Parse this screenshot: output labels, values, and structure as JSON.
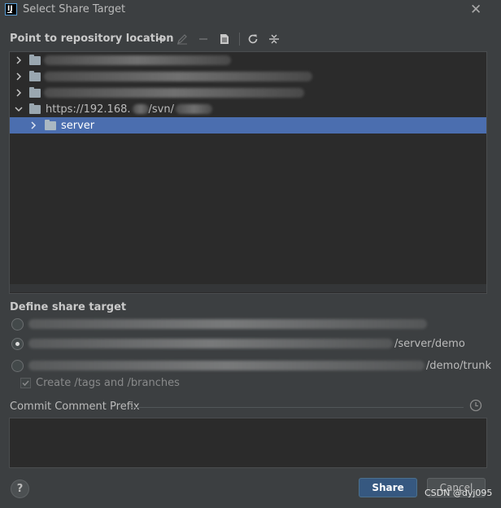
{
  "window": {
    "title": "Select Share Target",
    "app_icon_letter": "IJ"
  },
  "repository": {
    "section_title": "Point to repository location",
    "toolbar": [
      "add-icon",
      "edit-icon",
      "remove-icon",
      "browse-icon",
      "refresh-icon",
      "collapse-icon"
    ],
    "tree": [
      {
        "label": "",
        "expanded": false,
        "selected": false
      },
      {
        "label": "",
        "expanded": false,
        "selected": false
      },
      {
        "label": "",
        "expanded": false,
        "selected": false
      },
      {
        "label": "https://192.168.",
        "suffix": "/svn/",
        "expanded": true,
        "selected": false
      },
      {
        "label": "server",
        "expanded": false,
        "selected": true
      }
    ]
  },
  "share_target": {
    "section_title": "Define share target",
    "options": [
      {
        "text": "",
        "checked": false
      },
      {
        "text": "/server/demo",
        "checked": true
      },
      {
        "text": "/demo/trunk",
        "checked": false
      }
    ],
    "create_tags_label": "Create /tags and /branches",
    "create_tags_checked": true
  },
  "comment": {
    "label": "Commit Comment Prefix",
    "value": ""
  },
  "buttons": {
    "help": "?",
    "share": "Share",
    "cancel": "Cancel"
  },
  "watermark": "CSDN @dyj095",
  "colors": {
    "accent": "#4b6eaf",
    "share_button": "#365880",
    "background": "#3c3f41",
    "panel": "#2b2b2b"
  }
}
